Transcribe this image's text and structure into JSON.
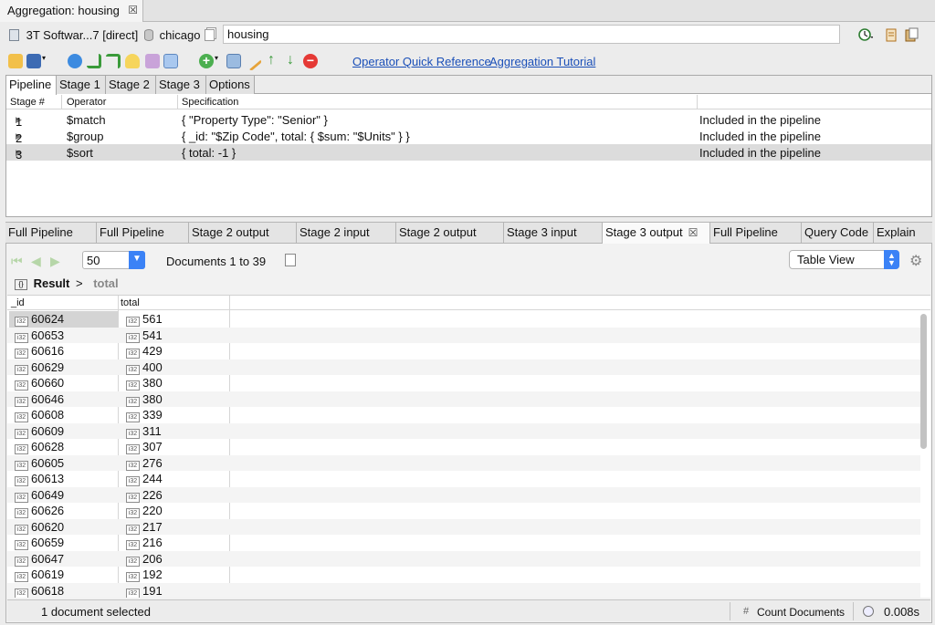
{
  "editor_tab": {
    "title": "Aggregation: housing",
    "close": "☒"
  },
  "connection": {
    "server": "3T Softwar...7 [direct]",
    "database": "chicago",
    "collection": "housing"
  },
  "links": {
    "quick_reference": "Operator Quick Reference",
    "tutorial": "Aggregation Tutorial"
  },
  "pipeline_tabs": [
    "Pipeline",
    "Stage 1",
    "Stage 2",
    "Stage 3",
    "Options"
  ],
  "pipeline_columns": {
    "stage": "Stage #",
    "operator": "Operator",
    "spec": "Specification"
  },
  "stages": [
    {
      "num": "1",
      "operator": "$match",
      "spec": "{ \"Property Type\": \"Senior\" }",
      "status": "Included in the pipeline"
    },
    {
      "num": "2",
      "operator": "$group",
      "spec": "{ _id: \"$Zip Code\", total: { $sum: \"$Units\" } }",
      "status": "Included in the pipeline"
    },
    {
      "num": "3",
      "operator": "$sort",
      "spec": "{ total: -1 }",
      "status": "Included in the pipeline"
    }
  ],
  "output_tabs": [
    "Full Pipeline",
    "Full Pipeline",
    "Stage 2 output",
    "Stage 2 input",
    "Stage 2 output",
    "Stage 3 input",
    "Stage 3 output",
    "Full Pipeline",
    "Query Code",
    "Explain"
  ],
  "output_tab_close": "☒",
  "pager": {
    "page_size": "50",
    "documents": "Documents 1 to 39"
  },
  "view": {
    "selected": "Table View"
  },
  "breadcrumb": {
    "root": "Result",
    "sep": ">",
    "field": "total"
  },
  "grid_columns": {
    "id": "_id",
    "total": "total"
  },
  "type_badge": "i32",
  "rows": [
    {
      "id": "60624",
      "total": "561"
    },
    {
      "id": "60653",
      "total": "541"
    },
    {
      "id": "60616",
      "total": "429"
    },
    {
      "id": "60629",
      "total": "400"
    },
    {
      "id": "60660",
      "total": "380"
    },
    {
      "id": "60646",
      "total": "380"
    },
    {
      "id": "60608",
      "total": "339"
    },
    {
      "id": "60609",
      "total": "311"
    },
    {
      "id": "60628",
      "total": "307"
    },
    {
      "id": "60605",
      "total": "276"
    },
    {
      "id": "60613",
      "total": "244"
    },
    {
      "id": "60649",
      "total": "226"
    },
    {
      "id": "60626",
      "total": "220"
    },
    {
      "id": "60620",
      "total": "217"
    },
    {
      "id": "60659",
      "total": "216"
    },
    {
      "id": "60647",
      "total": "206"
    },
    {
      "id": "60619",
      "total": "192"
    },
    {
      "id": "60618",
      "total": "191"
    }
  ],
  "status": {
    "selection": "1 document selected",
    "count_button": "Count Documents",
    "time": "0.008s"
  },
  "colors": {
    "link": "#1a4fb8",
    "dropdown_accent": "#3b82f6",
    "selected_row": "#dcdcdc"
  }
}
